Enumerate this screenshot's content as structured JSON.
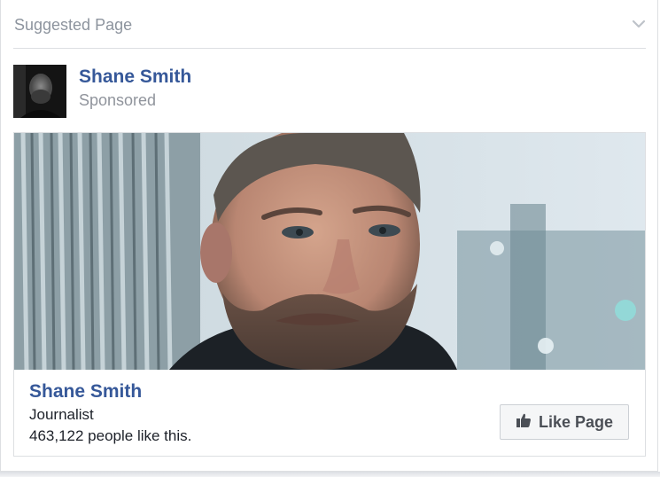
{
  "header": {
    "title": "Suggested Page"
  },
  "post": {
    "page_name": "Shane Smith",
    "sponsored_label": "Sponsored"
  },
  "ad": {
    "title": "Shane Smith",
    "category": "Journalist",
    "likes_text": "463,122 people like this.",
    "button_label": "Like Page"
  },
  "icons": {
    "menu": "chevron-down-icon",
    "like": "thumbs-up-icon"
  },
  "colors": {
    "link": "#365899",
    "muted": "#90949c",
    "text": "#1d2129"
  }
}
